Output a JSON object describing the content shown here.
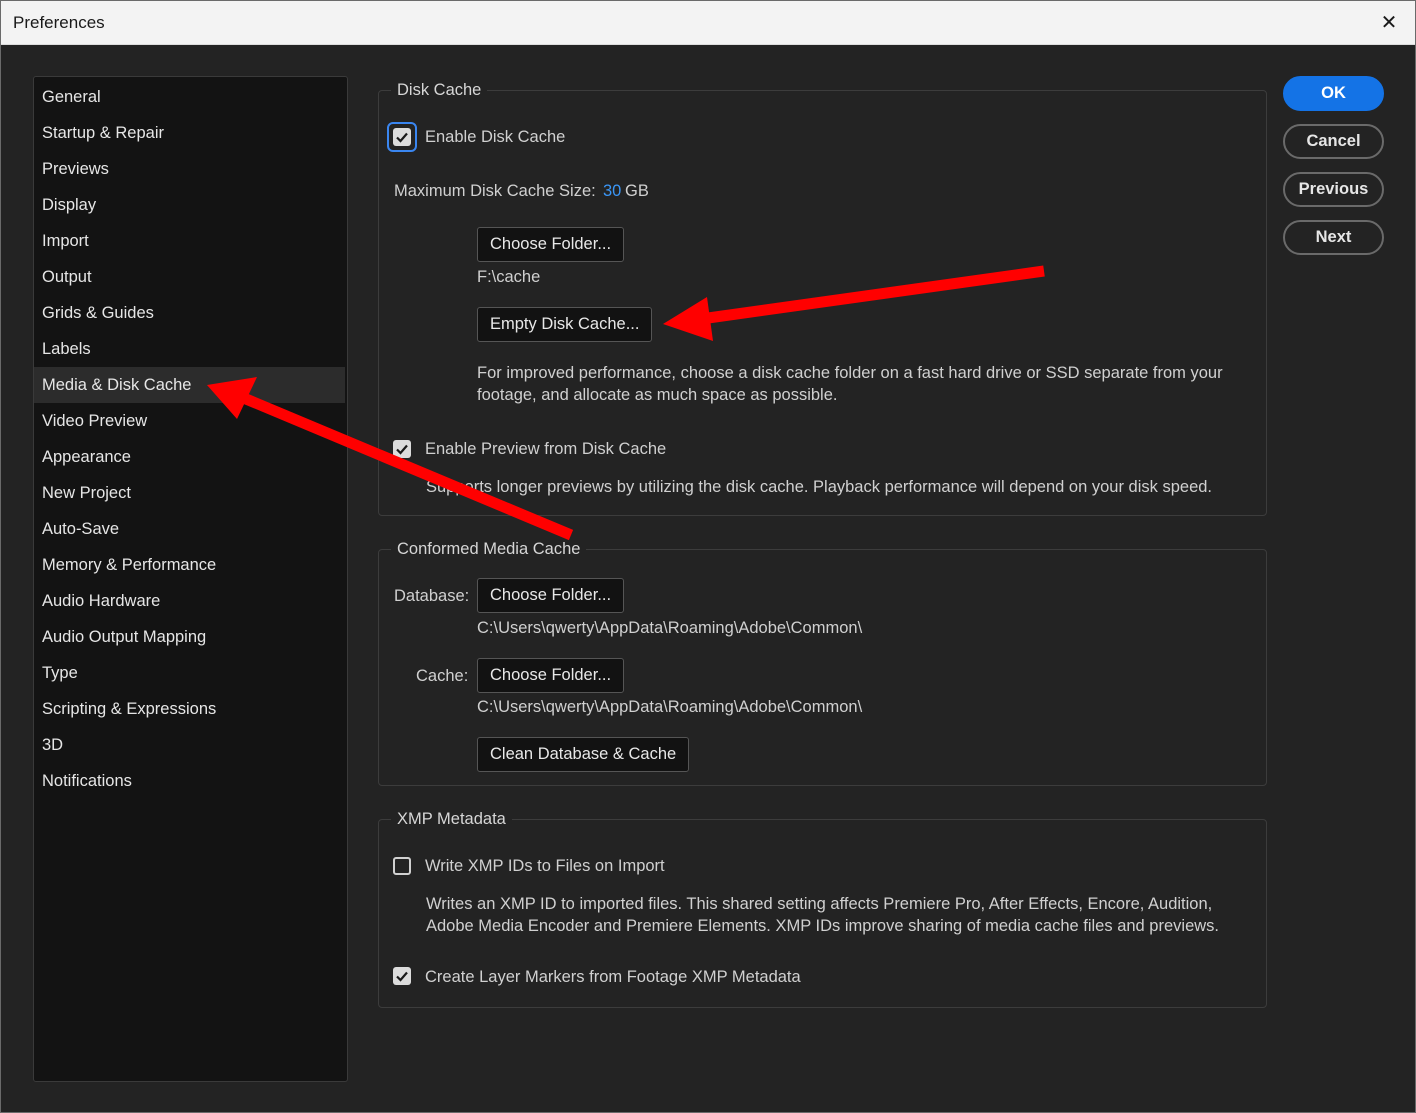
{
  "window": {
    "title": "Preferences"
  },
  "sidebar": {
    "items": [
      {
        "label": "General"
      },
      {
        "label": "Startup & Repair"
      },
      {
        "label": "Previews"
      },
      {
        "label": "Display"
      },
      {
        "label": "Import"
      },
      {
        "label": "Output"
      },
      {
        "label": "Grids & Guides"
      },
      {
        "label": "Labels"
      },
      {
        "label": "Media & Disk Cache",
        "selected": true
      },
      {
        "label": "Video Preview"
      },
      {
        "label": "Appearance"
      },
      {
        "label": "New Project"
      },
      {
        "label": "Auto-Save"
      },
      {
        "label": "Memory & Performance"
      },
      {
        "label": "Audio Hardware"
      },
      {
        "label": "Audio Output Mapping"
      },
      {
        "label": "Type"
      },
      {
        "label": "Scripting & Expressions"
      },
      {
        "label": "3D"
      },
      {
        "label": "Notifications"
      }
    ]
  },
  "disk_cache": {
    "title": "Disk Cache",
    "enable_label": "Enable Disk Cache",
    "enable_checked": true,
    "max_size_label": "Maximum Disk Cache Size:",
    "max_size_value": "30",
    "max_size_unit": "GB",
    "choose_folder_label": "Choose Folder...",
    "folder_path": "F:\\cache",
    "empty_label": "Empty Disk Cache...",
    "hint": "For improved performance, choose a disk cache folder on a fast hard drive or SSD separate from your footage, and allocate as much space as possible.",
    "preview_label": "Enable Preview from Disk Cache",
    "preview_checked": true,
    "preview_hint": "Supports longer previews by utilizing the disk cache. Playback performance will depend on your disk speed."
  },
  "conformed": {
    "title": "Conformed Media Cache",
    "database_label": "Database:",
    "database_button": "Choose Folder...",
    "database_path": "C:\\Users\\qwerty\\AppData\\Roaming\\Adobe\\Common\\",
    "cache_label": "Cache:",
    "cache_button": "Choose Folder...",
    "cache_path": "C:\\Users\\qwerty\\AppData\\Roaming\\Adobe\\Common\\",
    "clean_label": "Clean Database & Cache"
  },
  "xmp": {
    "title": "XMP Metadata",
    "write_label": "Write XMP IDs to Files on Import",
    "write_checked": false,
    "write_hint": "Writes an XMP ID to imported files. This shared setting affects Premiere Pro, After Effects, Encore, Audition, Adobe Media Encoder and Premiere Elements. XMP IDs improve sharing of media cache files and previews.",
    "markers_label": "Create Layer Markers from Footage XMP Metadata",
    "markers_checked": true
  },
  "actions": {
    "ok": "OK",
    "cancel": "Cancel",
    "previous": "Previous",
    "next": "Next"
  },
  "colors": {
    "accent": "#1473e6",
    "value_blue": "#3b96f5",
    "annotation_arrow": "#ff0000",
    "background": "#232323",
    "sidebar_bg": "#131313"
  }
}
